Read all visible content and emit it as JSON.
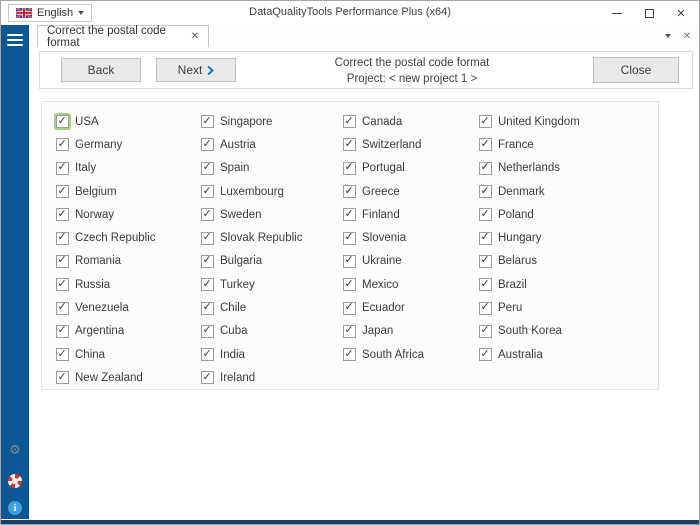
{
  "titlebar": {
    "app_title": "DataQualityTools Performance Plus (x64)",
    "language_label": "English"
  },
  "tabbar": {
    "active_tab_label": "Correct the postal code format"
  },
  "wizard_header": {
    "back_label": "Back",
    "next_label": "Next",
    "close_label": "Close",
    "title": "Correct the postal code format",
    "project_line": "Project: < new project 1 >"
  },
  "countries": {
    "all_checked": true,
    "focused_item": "USA",
    "items": [
      "USA",
      "Singapore",
      "Canada",
      "United Kingdom",
      "Germany",
      "Austria",
      "Switzerland",
      "France",
      "Italy",
      "Spain",
      "Portugal",
      "Netherlands",
      "Belgium",
      "Luxembourg",
      "Greece",
      "Denmark",
      "Norway",
      "Sweden",
      "Finland",
      "Poland",
      "Czech Republic",
      "Slovak Republic",
      "Slovenia",
      "Hungary",
      "Romania",
      "Bulgaria",
      "Ukraine",
      "Belarus",
      "Russia",
      "Turkey",
      "Mexico",
      "Brazil",
      "Venezuela",
      "Chile",
      "Ecuador",
      "Peru",
      "Argentina",
      "Cuba",
      "Japan",
      "South Korea",
      "China",
      "India",
      "South Africa",
      "Australia",
      "New Zealand",
      "Ireland"
    ]
  },
  "sidebar": {
    "icons": [
      "menu-icon",
      "settings-gear-icon",
      "help-lifebuoy-icon",
      "info-icon"
    ]
  },
  "colors": {
    "sidebar_blue": "#0c5796",
    "accent_blue": "#1d76c4",
    "focus_green": "#a6d17a",
    "bottom_bar_navy": "#1a3e64",
    "lifebuoy_red": "#cf3a26",
    "info_blue": "#41a1e0"
  }
}
